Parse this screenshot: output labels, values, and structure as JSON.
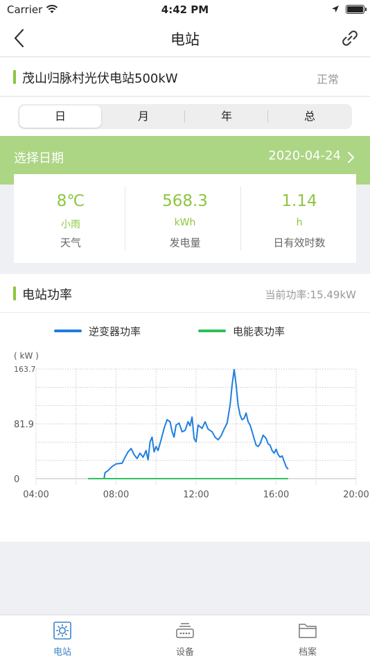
{
  "status_bar": {
    "carrier": "Carrier",
    "time": "4:42 PM"
  },
  "nav": {
    "title": "电站"
  },
  "station": {
    "name": "茂山归脉村光伏电站500kW",
    "status": "正常"
  },
  "period_tabs": [
    {
      "label": "日",
      "active": true
    },
    {
      "label": "月",
      "active": false
    },
    {
      "label": "年",
      "active": false
    },
    {
      "label": "总",
      "active": false
    }
  ],
  "date_selector": {
    "label": "选择日期",
    "value": "2020-04-24"
  },
  "stats": [
    {
      "value": "8℃",
      "unit": "小雨",
      "label": "天气"
    },
    {
      "value": "568.3",
      "unit": "kWh",
      "label": "发电量"
    },
    {
      "value": "1.14",
      "unit": "h",
      "label": "日有效时数"
    }
  ],
  "power_section": {
    "title": "电站功率",
    "current_label": "当前功率:",
    "current_value": "15.49kW"
  },
  "colors": {
    "accent_green": "#8cc63f",
    "date_bar": "#acd584",
    "inverter_line": "#1e7fe0",
    "meter_line": "#2fbf5a",
    "tab_active": "#3a83c9"
  },
  "chart_data": {
    "type": "line",
    "unit_label": "( kW )",
    "x_ticks": [
      "04:00",
      "08:00",
      "12:00",
      "16:00",
      "20:00"
    ],
    "x_range": [
      4,
      20
    ],
    "y_ticks": [
      "0",
      "81.9",
      "163.7"
    ],
    "y_range": [
      0,
      163.7
    ],
    "grid": true,
    "legend_position": "top",
    "series": [
      {
        "name": "逆变器功率",
        "color": "#1e7fe0",
        "points": [
          [
            7.25,
            0
          ],
          [
            7.4,
            0
          ],
          [
            7.45,
            9
          ],
          [
            7.6,
            12
          ],
          [
            7.8,
            18
          ],
          [
            8.0,
            22
          ],
          [
            8.3,
            23
          ],
          [
            8.45,
            32
          ],
          [
            8.6,
            40
          ],
          [
            8.75,
            45
          ],
          [
            8.9,
            36
          ],
          [
            9.05,
            30
          ],
          [
            9.2,
            38
          ],
          [
            9.35,
            32
          ],
          [
            9.5,
            42
          ],
          [
            9.6,
            28
          ],
          [
            9.7,
            55
          ],
          [
            9.8,
            62
          ],
          [
            9.9,
            40
          ],
          [
            10.0,
            48
          ],
          [
            10.1,
            42
          ],
          [
            10.25,
            58
          ],
          [
            10.4,
            75
          ],
          [
            10.55,
            88
          ],
          [
            10.7,
            85
          ],
          [
            10.8,
            70
          ],
          [
            10.9,
            62
          ],
          [
            11.0,
            80
          ],
          [
            11.15,
            83
          ],
          [
            11.3,
            70
          ],
          [
            11.45,
            72
          ],
          [
            11.6,
            85
          ],
          [
            11.7,
            79
          ],
          [
            11.8,
            92
          ],
          [
            11.9,
            60
          ],
          [
            12.0,
            55
          ],
          [
            12.1,
            80
          ],
          [
            12.3,
            75
          ],
          [
            12.45,
            85
          ],
          [
            12.6,
            74
          ],
          [
            12.8,
            70
          ],
          [
            12.95,
            62
          ],
          [
            13.1,
            58
          ],
          [
            13.25,
            64
          ],
          [
            13.4,
            74
          ],
          [
            13.55,
            83
          ],
          [
            13.7,
            110
          ],
          [
            13.8,
            140
          ],
          [
            13.9,
            163
          ],
          [
            14.0,
            140
          ],
          [
            14.1,
            110
          ],
          [
            14.2,
            95
          ],
          [
            14.3,
            88
          ],
          [
            14.4,
            90
          ],
          [
            14.5,
            98
          ],
          [
            14.6,
            85
          ],
          [
            14.7,
            80
          ],
          [
            14.8,
            70
          ],
          [
            14.9,
            60
          ],
          [
            15.0,
            50
          ],
          [
            15.1,
            48
          ],
          [
            15.2,
            52
          ],
          [
            15.35,
            65
          ],
          [
            15.5,
            60
          ],
          [
            15.6,
            52
          ],
          [
            15.7,
            50
          ],
          [
            15.8,
            42
          ],
          [
            15.9,
            38
          ],
          [
            16.0,
            44
          ],
          [
            16.1,
            36
          ],
          [
            16.2,
            32
          ],
          [
            16.3,
            34
          ],
          [
            16.4,
            26
          ],
          [
            16.5,
            18
          ],
          [
            16.6,
            14
          ]
        ]
      },
      {
        "name": "电能表功率",
        "color": "#2fbf5a",
        "points": [
          [
            6.6,
            0
          ],
          [
            16.6,
            0
          ]
        ]
      }
    ]
  },
  "bottom_tabs": [
    {
      "label": "电站",
      "icon": "sun-icon",
      "active": true
    },
    {
      "label": "设备",
      "icon": "device-icon",
      "active": false
    },
    {
      "label": "档案",
      "icon": "folder-icon",
      "active": false
    }
  ]
}
